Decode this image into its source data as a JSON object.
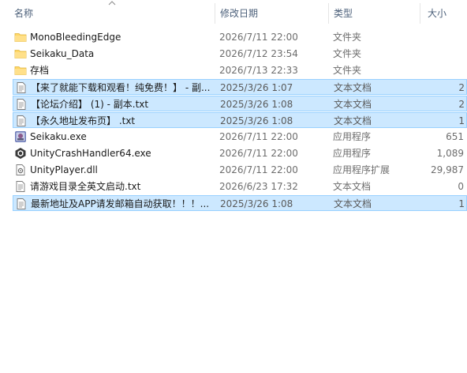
{
  "columns": {
    "name": "名称",
    "date": "修改日期",
    "type": "类型",
    "size": "大小"
  },
  "files": [
    {
      "name": "MonoBleedingEdge",
      "date": "2026/7/11 22:00",
      "type": "文件夹",
      "size": "",
      "icon": "folder-icon",
      "selected": false
    },
    {
      "name": "Seikaku_Data",
      "date": "2026/7/12 23:54",
      "type": "文件夹",
      "size": "",
      "icon": "folder-icon",
      "selected": false
    },
    {
      "name": "存档",
      "date": "2026/7/13 22:33",
      "type": "文件夹",
      "size": "",
      "icon": "folder-icon",
      "selected": false
    },
    {
      "name": "【来了就能下载和观看！纯免费！】 - 副...",
      "date": "2025/3/26 1:07",
      "type": "文本文档",
      "size": "2",
      "icon": "text-file-icon",
      "selected": true
    },
    {
      "name": "【论坛介绍】 (1) - 副本.txt",
      "date": "2025/3/26 1:08",
      "type": "文本文档",
      "size": "2",
      "icon": "text-file-icon",
      "selected": true
    },
    {
      "name": "【永久地址发布页】 .txt",
      "date": "2025/3/26 1:08",
      "type": "文本文档",
      "size": "1",
      "icon": "text-file-icon",
      "selected": true
    },
    {
      "name": "Seikaku.exe",
      "date": "2026/7/11 22:00",
      "type": "应用程序",
      "size": "651",
      "icon": "app-exe-icon",
      "selected": false
    },
    {
      "name": "UnityCrashHandler64.exe",
      "date": "2026/7/11 22:00",
      "type": "应用程序",
      "size": "1,089",
      "icon": "unity-icon",
      "selected": false
    },
    {
      "name": "UnityPlayer.dll",
      "date": "2026/7/11 22:00",
      "type": "应用程序扩展",
      "size": "29,987",
      "icon": "dll-file-icon",
      "selected": false
    },
    {
      "name": "请游戏目录全英文启动.txt",
      "date": "2026/6/23 17:32",
      "type": "文本文档",
      "size": "0",
      "icon": "text-file-icon",
      "selected": false
    },
    {
      "name": "最新地址及APP请发邮箱自动获取！！！...",
      "date": "2025/3/26 1:08",
      "type": "文本文档",
      "size": "1",
      "icon": "text-file-icon",
      "selected": true
    }
  ]
}
